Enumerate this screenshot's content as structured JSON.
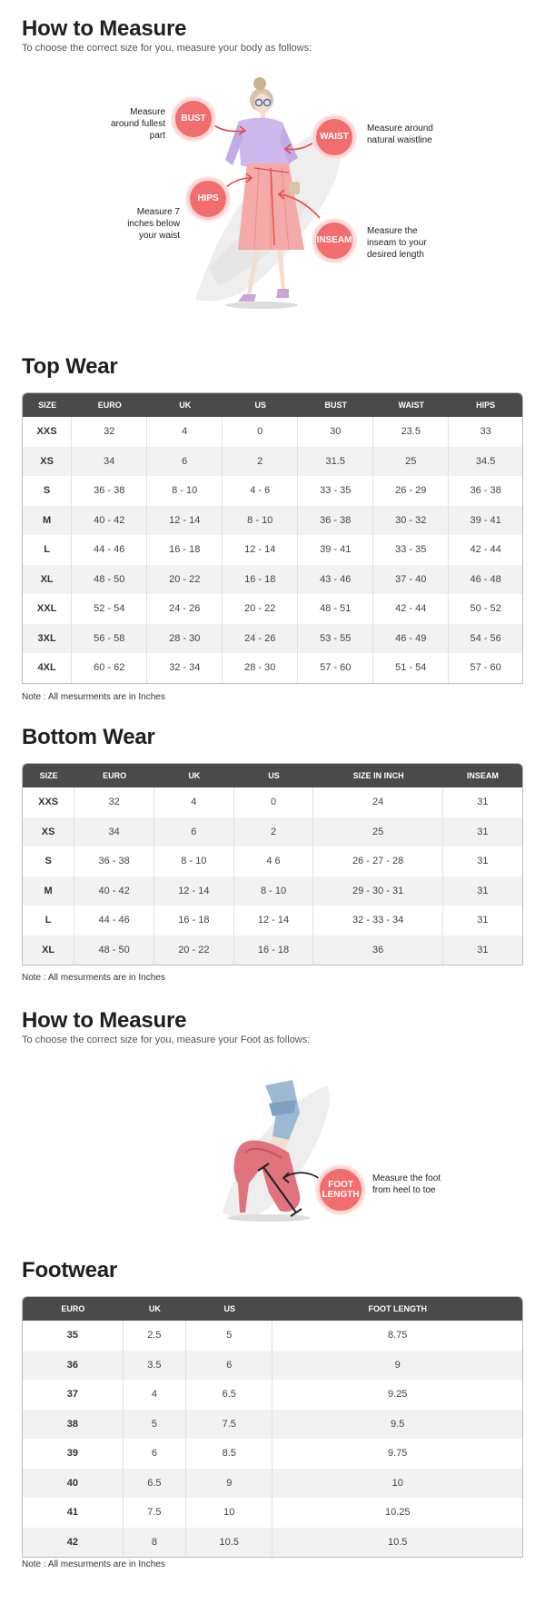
{
  "measure_top": {
    "title": "How to Measure",
    "subtitle": "To choose the correct size for you, measure your body as follows:",
    "bubbles": {
      "bust": "BUST",
      "waist": "WAIST",
      "hips": "HIPS",
      "inseam": "INSEAM"
    },
    "callouts": {
      "bust": "Measure around fullest part",
      "waist": "Measure around natural waistline",
      "hips": "Measure 7 inches below your waist",
      "inseam": "Measure the inseam  to your desired length"
    }
  },
  "top_wear": {
    "title": "Top Wear",
    "headers": [
      "SIZE",
      "EURO",
      "UK",
      "US",
      "BUST",
      "WAIST",
      "HIPS"
    ],
    "rows": [
      [
        "XXS",
        "32",
        "4",
        "0",
        "30",
        "23.5",
        "33"
      ],
      [
        "XS",
        "34",
        "6",
        "2",
        "31.5",
        "25",
        "34.5"
      ],
      [
        "S",
        "36 - 38",
        "8 - 10",
        "4 - 6",
        "33 - 35",
        "26 - 29",
        "36 - 38"
      ],
      [
        "M",
        "40 - 42",
        "12 - 14",
        "8 - 10",
        "36 - 38",
        "30 - 32",
        "39 - 41"
      ],
      [
        "L",
        "44 - 46",
        "16 - 18",
        "12 - 14",
        "39 - 41",
        "33 - 35",
        "42 - 44"
      ],
      [
        "XL",
        "48 - 50",
        "20 - 22",
        "16 - 18",
        "43 - 46",
        "37 - 40",
        "46 - 48"
      ],
      [
        "XXL",
        "52 - 54",
        "24 - 26",
        "20 - 22",
        "48 - 51",
        "42 - 44",
        "50 - 52"
      ],
      [
        "3XL",
        "56 - 58",
        "28 - 30",
        "24 - 26",
        "53 - 55",
        "46 - 49",
        "54 - 56"
      ],
      [
        "4XL",
        "60 - 62",
        "32 - 34",
        "28 - 30",
        "57 - 60",
        "51 - 54",
        "57 - 60"
      ]
    ],
    "note": "Note : All mesurments are in Inches"
  },
  "bottom_wear": {
    "title": "Bottom Wear",
    "headers": [
      "SIZE",
      "EURO",
      "UK",
      "US",
      "SIZE IN INCH",
      "INSEAM"
    ],
    "rows": [
      [
        "XXS",
        "32",
        "4",
        "0",
        "24",
        "31"
      ],
      [
        "XS",
        "34",
        "6",
        "2",
        "25",
        "31"
      ],
      [
        "S",
        "36 - 38",
        "8 - 10",
        "4 6",
        "26 - 27 - 28",
        "31"
      ],
      [
        "M",
        "40 - 42",
        "12 - 14",
        "8 - 10",
        "29 - 30 - 31",
        "31"
      ],
      [
        "L",
        "44 - 46",
        "16 - 18",
        "12 - 14",
        "32 - 33 - 34",
        "31"
      ],
      [
        "XL",
        "48 - 50",
        "20 - 22",
        "16 - 18",
        "36",
        "31"
      ]
    ],
    "note": "Note : All mesurments are in Inches"
  },
  "measure_foot": {
    "title": "How to Measure",
    "subtitle": "To choose the correct size for you, measure your Foot as follows:",
    "bubble": "FOOT LENGTH",
    "callout": "Measure the foot from heel to toe"
  },
  "footwear": {
    "title": "Footwear",
    "headers": [
      "EURO",
      "UK",
      "US",
      "FOOT LENGTH"
    ],
    "rows": [
      [
        "35",
        "2.5",
        "5",
        "8.75"
      ],
      [
        "36",
        "3.5",
        "6",
        "9"
      ],
      [
        "37",
        "4",
        "6.5",
        "9.25"
      ],
      [
        "38",
        "5",
        "7.5",
        "9.5"
      ],
      [
        "39",
        "6",
        "8.5",
        "9.75"
      ],
      [
        "40",
        "6.5",
        "9",
        "10"
      ],
      [
        "41",
        "7.5",
        "10",
        "10.25"
      ],
      [
        "42",
        "8",
        "10.5",
        "10.5"
      ]
    ],
    "note": "Note : All mesurments are in Inches"
  },
  "colors": {
    "accent": "#f26d6d",
    "header_bg": "#4a4a4a",
    "alt_row": "#f2f2f2"
  }
}
